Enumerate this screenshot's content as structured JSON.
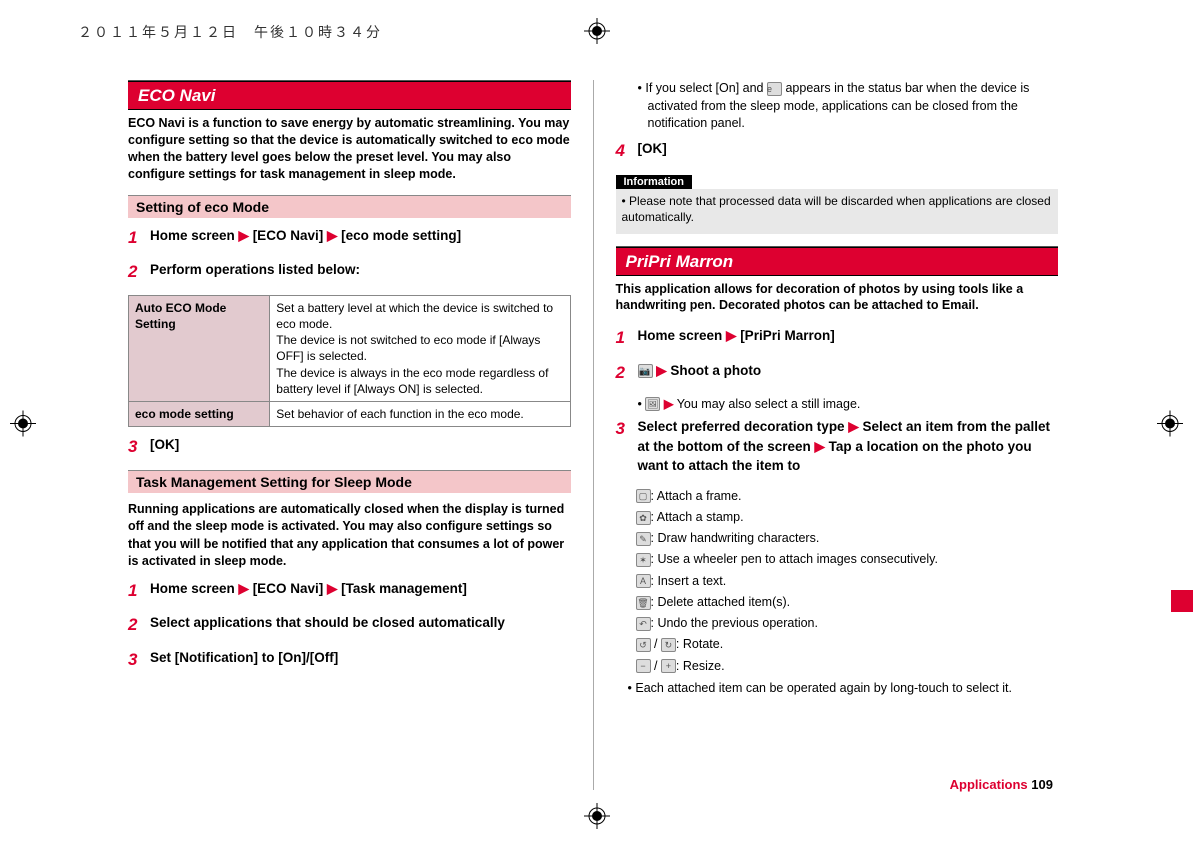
{
  "header": {
    "date": "２０１１年５月１２日　午後１０時３４分"
  },
  "left": {
    "eco_navi": {
      "title": "ECO Navi",
      "intro": "ECO Navi is a function to save energy by automatic streamlining. You may configure setting so that the device is automatically switched to eco mode when the battery level goes below the preset level. You may also configure settings for task management in sleep mode.",
      "setting_heading": "Setting of eco Mode",
      "step1": {
        "n": "1",
        "a": "Home screen ",
        "b": " [ECO Navi] ",
        "c": " [eco mode setting]"
      },
      "step2": {
        "n": "2",
        "text": "Perform operations listed below:"
      },
      "table": {
        "r1h": "Auto ECO Mode Setting",
        "r1c": "Set a battery level at which the device is switched to eco mode.\nThe device is not switched to eco mode if [Always OFF] is selected.\nThe device is always in the eco mode regardless of battery level if [Always ON] is selected.",
        "r2h": "eco mode setting",
        "r2c": "Set behavior of each function in the eco mode."
      },
      "step3": {
        "n": "3",
        "text": "[OK]"
      },
      "task_heading": "Task Management Setting for Sleep Mode",
      "task_intro": "Running applications are automatically closed when the display is turned off and the sleep mode is activated. You may also configure settings so that you will be notified that any application that consumes a lot of power is activated in sleep mode.",
      "tstep1": {
        "n": "1",
        "a": "Home screen ",
        "b": " [ECO Navi] ",
        "c": " [Task management]"
      },
      "tstep2": {
        "n": "2",
        "text": "Select applications that should be closed automatically"
      },
      "tstep3": {
        "n": "3",
        "text": "Set [Notification] to [On]/[Off]"
      }
    }
  },
  "right": {
    "cont": {
      "bullet1a": "If you select [On] and ",
      "bullet1b": " appears in the status bar when the device is activated from the sleep mode, applications can be closed from the notification panel.",
      "step4": {
        "n": "4",
        "text": "[OK]"
      },
      "info_label": "Information",
      "info_text": "Please note that processed data will be discarded when applications are closed automatically."
    },
    "pripri": {
      "title": "PriPri Marron",
      "intro": "This application allows for decoration of photos by using tools like a handwriting pen. Decorated photos can be attached to Email.",
      "step1": {
        "n": "1",
        "a": "Home screen ",
        "b": " [PriPri Marron]"
      },
      "step2": {
        "n": "2",
        "text": " Shoot a photo"
      },
      "step2_sub": " You may also select a still image.",
      "step3": {
        "n": "3",
        "a": "Select preferred decoration type ",
        "b": " Select an item from the pallet at the bottom of the screen ",
        "c": " Tap a location on the photo you want to attach the item to"
      },
      "icons": {
        "i1": ": Attach a frame.",
        "i2": ": Attach a stamp.",
        "i3": ": Draw handwriting characters.",
        "i4": ": Use a wheeler pen to attach images consecutively.",
        "i5": ": Insert a text.",
        "i6": ": Delete attached item(s).",
        "i7": ": Undo the previous operation.",
        "i8": ": Rotate.",
        "i9": ": Resize."
      },
      "footnote": "Each attached item can be operated again by long-touch to select it."
    }
  },
  "footer": {
    "section": "Applications",
    "page": "109"
  },
  "glyphs": {
    "arrow": "▶",
    "bullet": "•"
  }
}
